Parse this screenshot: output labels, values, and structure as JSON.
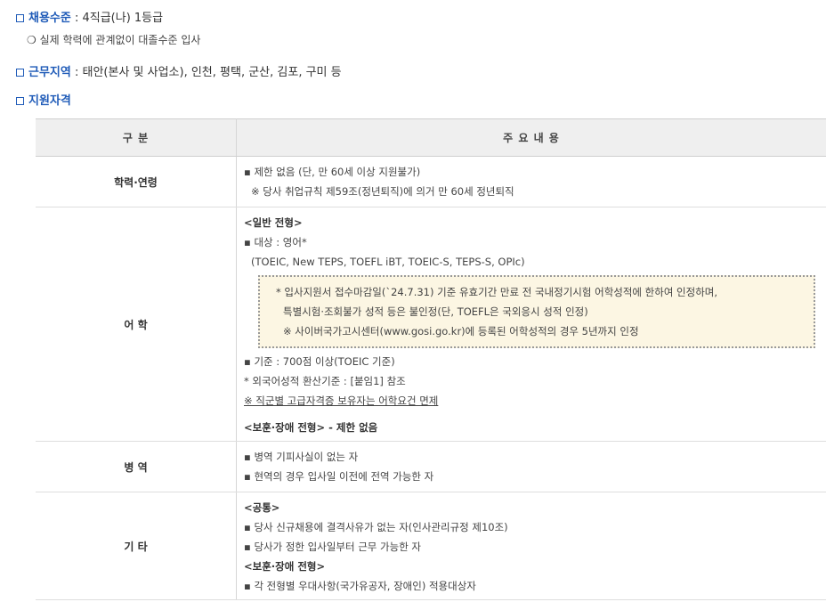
{
  "sections": {
    "grade": {
      "key": "채용수준",
      "value": " : 4직급(나) 1등급",
      "note": "❍ 실제 학력에 관계없이 대졸수준 입사"
    },
    "location": {
      "key": "근무지역",
      "value": " : 태안(본사 및 사업소), 인천, 평택, 군산, 김포, 구미 등"
    },
    "qualifications": {
      "key": "지원자격"
    }
  },
  "table": {
    "headers": [
      "구 분",
      "주 요 내 용"
    ],
    "education": {
      "label": "학력·연령",
      "lines": [
        "▪ 제한 없음 (단, 만 60세 이상 지원불가)",
        "※ 당사 취업규칙 제59조(정년퇴직)에 의거 만 60세 정년퇴직"
      ]
    },
    "language": {
      "label": "어 학",
      "general_title": "<일반 전형>",
      "target": "▪ 대상 : 영어*",
      "tests": "(TOEIC, New TEPS, TOEFL iBT, TOEIC-S, TEPS-S, OPIc)",
      "note_lines": [
        "* 입사지원서 접수마감일(`24.7.31) 기준 유효기간 만료 전 국내정기시험 어학성적에 한하여 인정하며,",
        "특별시험·조회불가 성적 등은 불인정(단, TOEFL은 국외응시 성적 인정)",
        "※ 사이버국가고시센터(www.gosi.go.kr)에 등록된 어학성적의 경우 5년까지 인정"
      ],
      "criteria": "▪ 기준 : 700점 이상(TOEIC 기준)",
      "conversion": "* 외국어성적 환산기준 : [붙임1] 참조",
      "exemption": "※ 직군별 고급자격증 보유자는 어학요건 면제",
      "veterans": "<보훈·장애 전형> - 제한 없음"
    },
    "military": {
      "label": "병 역",
      "lines": [
        "▪ 병역 기피사실이 없는 자",
        "▪ 현역의 경우 입사일 이전에 전역 가능한 자"
      ]
    },
    "other": {
      "label": "기 타",
      "common_title": "<공통>",
      "common_lines": [
        "▪ 당사 신규채용에 결격사유가 없는 자(인사관리규정 제10조)",
        "▪ 당사가 정한 입사일부터 근무 가능한 자"
      ],
      "veterans_title": "<보훈·장애 전형>",
      "veterans_lines": [
        "▪ 각 전형별 우대사항(국가유공자, 장애인) 적용대상자"
      ]
    }
  }
}
